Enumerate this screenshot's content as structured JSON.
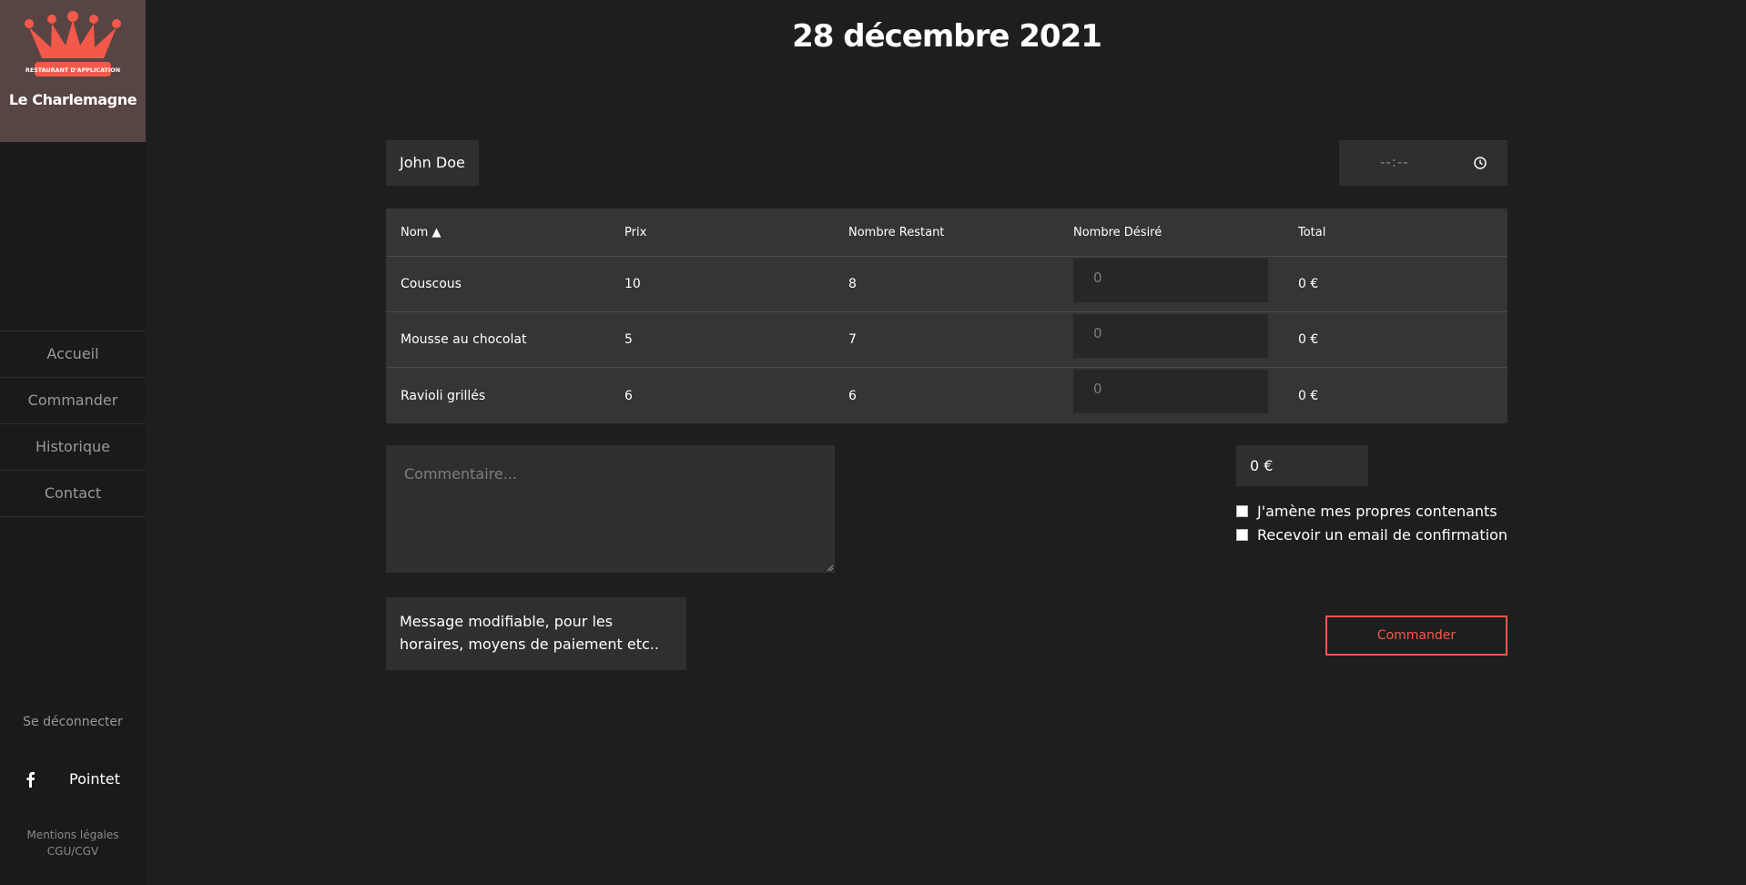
{
  "sidebar": {
    "logo_badge_text": "RESTAURANT D'APPLICATION",
    "brand_name": "Le Charlemagne",
    "nav": [
      "Accueil",
      "Commander",
      "Historique",
      "Contact"
    ],
    "logout_label": "Se déconnecter",
    "social_icon": "facebook-icon",
    "social_label": "Pointet",
    "legal": [
      "Mentions légales",
      "CGU/CGV"
    ]
  },
  "main": {
    "title": "28 décembre 2021",
    "customer_name": "John Doe",
    "time_placeholder": "--:--",
    "table": {
      "headers": [
        "Nom ▲",
        "Prix",
        "Nombre Restant",
        "Nombre Désiré",
        "Total"
      ],
      "rows": [
        {
          "name": "Couscous",
          "price": "10",
          "remaining": "8",
          "desired_placeholder": "0",
          "total": "0 €"
        },
        {
          "name": "Mousse au chocolat",
          "price": "5",
          "remaining": "7",
          "desired_placeholder": "0",
          "total": "0 €"
        },
        {
          "name": "Ravioli grillés",
          "price": "6",
          "remaining": "6",
          "desired_placeholder": "0",
          "total": "0 €"
        }
      ]
    },
    "comment_placeholder": "Commentaire...",
    "grand_total": "0 €",
    "options": [
      "J'amène mes propres contenants",
      "Recevoir un email de confirmation"
    ],
    "message_lines": [
      "Message modifiable, pour les",
      "horaires, moyens de paiement etc.."
    ],
    "order_button": "Commander"
  },
  "colors": {
    "accent": "#f2594b",
    "logo_background": "#584443",
    "page_background": "#1e1e1e",
    "panel_background": "#2f2f2f",
    "table_background": "#353535"
  }
}
